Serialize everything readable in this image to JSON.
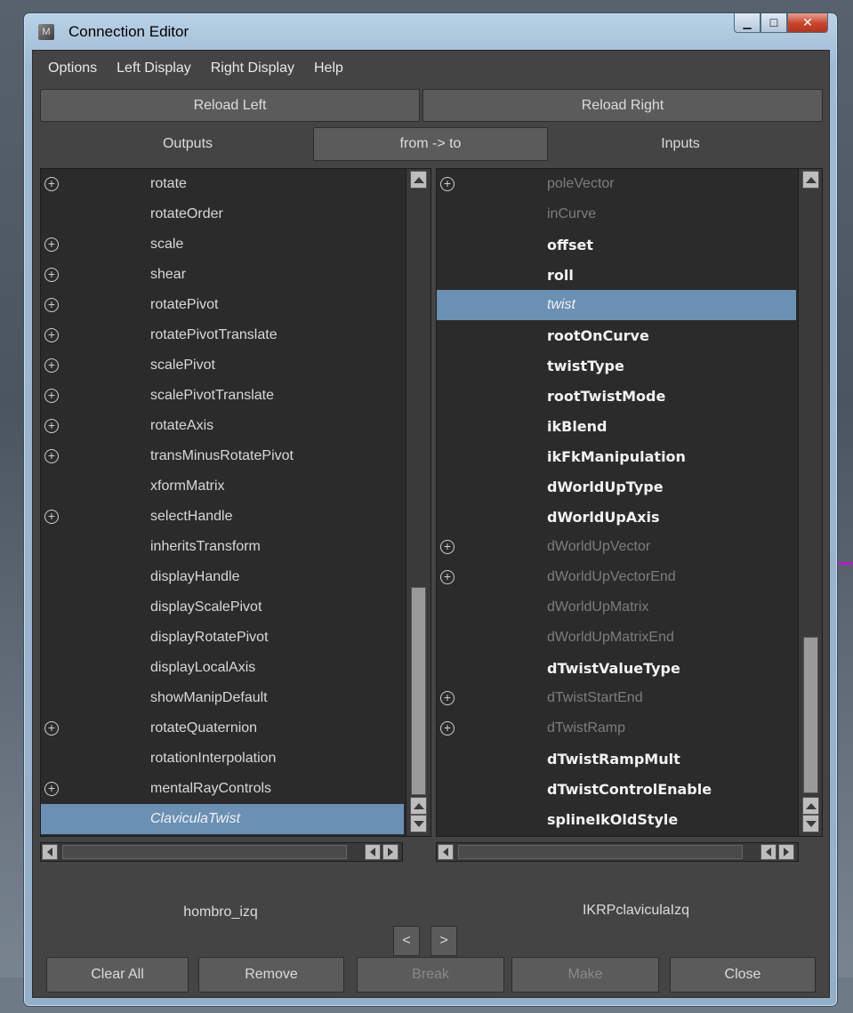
{
  "window": {
    "title": "Connection Editor"
  },
  "menu": [
    "Options",
    "Left Display",
    "Right Display",
    "Help"
  ],
  "reload": {
    "left": "Reload Left",
    "right": "Reload Right"
  },
  "header": {
    "outputs": "Outputs",
    "direction": "from -> to",
    "inputs": "Inputs"
  },
  "left_list": [
    {
      "label": "rotate",
      "plus": true,
      "style": "normal"
    },
    {
      "label": "rotateOrder",
      "plus": false,
      "style": "normal"
    },
    {
      "label": "scale",
      "plus": true,
      "style": "normal"
    },
    {
      "label": "shear",
      "plus": true,
      "style": "normal"
    },
    {
      "label": "rotatePivot",
      "plus": true,
      "style": "normal"
    },
    {
      "label": "rotatePivotTranslate",
      "plus": true,
      "style": "normal"
    },
    {
      "label": "scalePivot",
      "plus": true,
      "style": "normal"
    },
    {
      "label": "scalePivotTranslate",
      "plus": true,
      "style": "normal"
    },
    {
      "label": "rotateAxis",
      "plus": true,
      "style": "normal"
    },
    {
      "label": "transMinusRotatePivot",
      "plus": true,
      "style": "normal"
    },
    {
      "label": "xformMatrix",
      "plus": false,
      "style": "normal"
    },
    {
      "label": "selectHandle",
      "plus": true,
      "style": "normal"
    },
    {
      "label": "inheritsTransform",
      "plus": false,
      "style": "normal"
    },
    {
      "label": "displayHandle",
      "plus": false,
      "style": "normal"
    },
    {
      "label": "displayScalePivot",
      "plus": false,
      "style": "normal"
    },
    {
      "label": "displayRotatePivot",
      "plus": false,
      "style": "normal"
    },
    {
      "label": "displayLocalAxis",
      "plus": false,
      "style": "normal"
    },
    {
      "label": "showManipDefault",
      "plus": false,
      "style": "normal"
    },
    {
      "label": "rotateQuaternion",
      "plus": true,
      "style": "normal"
    },
    {
      "label": "rotationInterpolation",
      "plus": false,
      "style": "normal"
    },
    {
      "label": "mentalRayControls",
      "plus": true,
      "style": "normal"
    },
    {
      "label": "ClaviculaTwist",
      "plus": false,
      "style": "italic",
      "selected": true
    }
  ],
  "right_list": [
    {
      "label": "poleVector",
      "plus": true,
      "style": "dim"
    },
    {
      "label": "inCurve",
      "plus": false,
      "style": "dim"
    },
    {
      "label": "offset",
      "plus": false,
      "style": "bold"
    },
    {
      "label": "roll",
      "plus": false,
      "style": "bold"
    },
    {
      "label": "twist",
      "plus": false,
      "style": "italic",
      "selected": true
    },
    {
      "label": "rootOnCurve",
      "plus": false,
      "style": "bold"
    },
    {
      "label": "twistType",
      "plus": false,
      "style": "bold"
    },
    {
      "label": "rootTwistMode",
      "plus": false,
      "style": "bold"
    },
    {
      "label": "ikBlend",
      "plus": false,
      "style": "bold"
    },
    {
      "label": "ikFkManipulation",
      "plus": false,
      "style": "bold"
    },
    {
      "label": "dWorldUpType",
      "plus": false,
      "style": "bold"
    },
    {
      "label": "dWorldUpAxis",
      "plus": false,
      "style": "bold"
    },
    {
      "label": "dWorldUpVector",
      "plus": true,
      "style": "dim"
    },
    {
      "label": "dWorldUpVectorEnd",
      "plus": true,
      "style": "dim"
    },
    {
      "label": "dWorldUpMatrix",
      "plus": false,
      "style": "dim"
    },
    {
      "label": "dWorldUpMatrixEnd",
      "plus": false,
      "style": "dim"
    },
    {
      "label": "dTwistValueType",
      "plus": false,
      "style": "bold"
    },
    {
      "label": "dTwistStartEnd",
      "plus": true,
      "style": "dim"
    },
    {
      "label": "dTwistRamp",
      "plus": true,
      "style": "dim"
    },
    {
      "label": "dTwistRampMult",
      "plus": false,
      "style": "bold"
    },
    {
      "label": "dTwistControlEnable",
      "plus": false,
      "style": "bold"
    },
    {
      "label": "splineIkOldStyle",
      "plus": false,
      "style": "bold"
    }
  ],
  "nodes": {
    "left": "hombro_izq",
    "right": "IKRPclaviculaIzq"
  },
  "nav": {
    "prev": "<",
    "next": ">"
  },
  "footer": {
    "clear_all": "Clear All",
    "remove": "Remove",
    "break": "Break",
    "make": "Make",
    "close": "Close"
  },
  "colors": {
    "selection": "#6a90b4",
    "panel": "#444444",
    "list_bg": "#2b2b2b"
  },
  "icons": {
    "expand": "plus-circle-icon",
    "window_icon": "maya-app-icon"
  }
}
